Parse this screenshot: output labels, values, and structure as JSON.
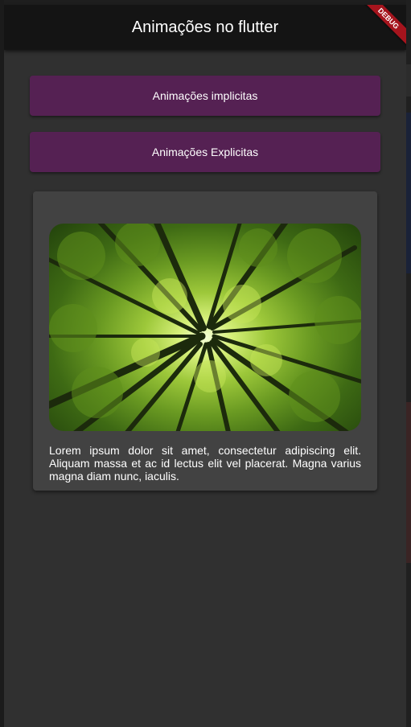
{
  "app_bar": {
    "title": "Animações no flutter",
    "debug_banner": "DEBUG"
  },
  "buttons": {
    "implicit_label": "Animações implicitas",
    "explicit_label": "Animações Explicitas"
  },
  "card": {
    "image_icon": "forest-canopy-image",
    "text": "Lorem ipsum dolor sit amet, consectetur adipiscing elit. Aliquam massa et ac id lectus elit vel placerat. Magna varius magna diam nunc, iaculis."
  },
  "colors": {
    "app_bar": "#141414",
    "background": "#303030",
    "button": "#552153",
    "card": "#424242",
    "debug_banner": "#a5141d"
  }
}
